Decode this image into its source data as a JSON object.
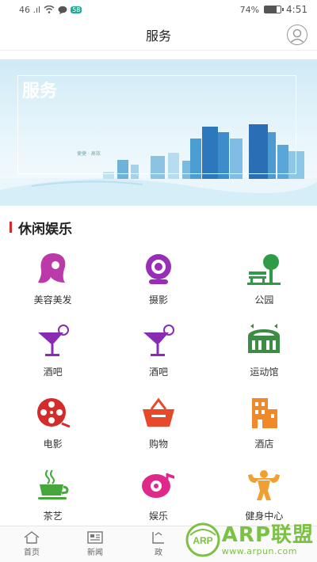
{
  "status": {
    "left_text": "46 .ıl",
    "right_percent": "74%",
    "time": "4:51",
    "battery_level": 0.74
  },
  "header": {
    "title": "服务"
  },
  "banner": {
    "title": "服务",
    "subtitle": "便捷 · 高效"
  },
  "section": {
    "title": "休闲娱乐"
  },
  "items": [
    {
      "label": "美容美发",
      "icon": "hair-salon-icon",
      "color": "#b93aa8"
    },
    {
      "label": "摄影",
      "icon": "camera-icon",
      "color": "#9a2db8"
    },
    {
      "label": "公园",
      "icon": "park-icon",
      "color": "#2e9b47"
    },
    {
      "label": "酒吧",
      "icon": "cocktail-icon",
      "color": "#8a2bb3"
    },
    {
      "label": "酒吧",
      "icon": "cocktail-icon",
      "color": "#8a2bb3"
    },
    {
      "label": "运动馆",
      "icon": "stadium-icon",
      "color": "#3c8c45"
    },
    {
      "label": "电影",
      "icon": "film-reel-icon",
      "color": "#d42b2b"
    },
    {
      "label": "购物",
      "icon": "shopping-basket-icon",
      "color": "#e8492a"
    },
    {
      "label": "酒店",
      "icon": "hotel-icon",
      "color": "#f08a28"
    },
    {
      "label": "茶艺",
      "icon": "tea-cup-icon",
      "color": "#46a83c"
    },
    {
      "label": "娱乐",
      "icon": "music-disc-icon",
      "color": "#e0288a"
    },
    {
      "label": "健身中心",
      "icon": "fitness-icon",
      "color": "#f0a030"
    }
  ],
  "tabs": [
    {
      "label": "首页",
      "icon": "home-icon"
    },
    {
      "label": "新闻",
      "icon": "news-icon"
    },
    {
      "label": "政",
      "icon": "gov-icon"
    }
  ],
  "watermark": {
    "main": "ARP联盟",
    "badge": "ARP",
    "url": "www.arpun.com"
  }
}
